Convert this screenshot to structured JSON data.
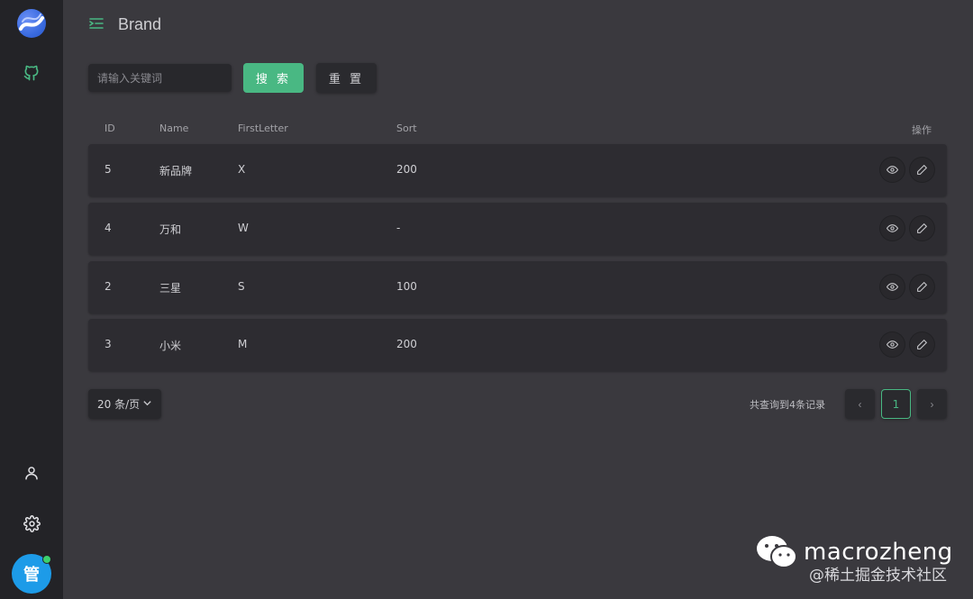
{
  "header": {
    "title": "Brand"
  },
  "search": {
    "placeholder": "请输入关键词",
    "search_label": "搜 索",
    "reset_label": "重 置"
  },
  "table": {
    "columns": [
      "ID",
      "Name",
      "FirstLetter",
      "Sort",
      "操作"
    ],
    "rows": [
      {
        "id": "5",
        "name": "新品牌",
        "first_letter": "X",
        "sort": "200"
      },
      {
        "id": "4",
        "name": "万和",
        "first_letter": "W",
        "sort": "-"
      },
      {
        "id": "2",
        "name": "三星",
        "first_letter": "S",
        "sort": "100"
      },
      {
        "id": "3",
        "name": "小米",
        "first_letter": "M",
        "sort": "200"
      }
    ]
  },
  "pagination": {
    "page_size": "20 条/页",
    "total_text": "共查询到4条记录",
    "current_page": "1",
    "prev": "‹",
    "next": "›"
  },
  "user": {
    "avatar_text": "管"
  },
  "watermark": {
    "name": "macrozheng",
    "sub": "@稀土掘金技术社区"
  },
  "colors": {
    "accent": "#49b883",
    "sidebar": "#232327",
    "background": "#3a393e",
    "row": "#2d2c31"
  }
}
